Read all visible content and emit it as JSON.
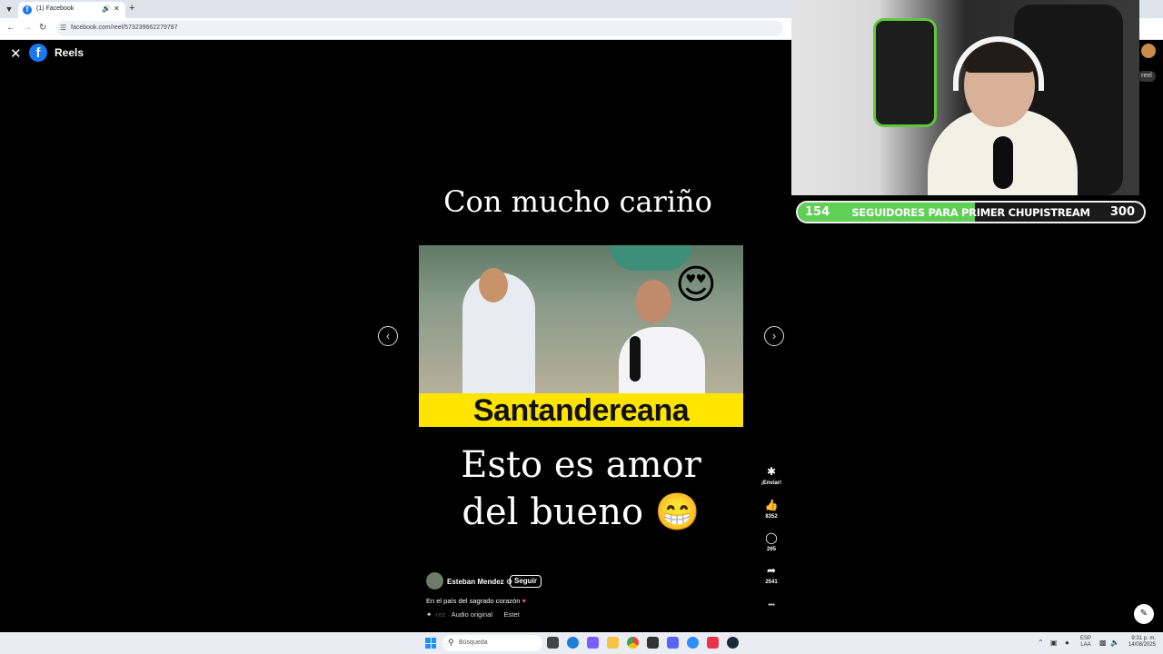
{
  "browser": {
    "tab_title": "(1) Facebook",
    "url": "facebook.com/reel/573239662279787",
    "icons": {
      "back": "arrow-left-icon",
      "forward": "arrow-right-icon",
      "reload": "reload-icon",
      "new_tab": "plus-icon"
    }
  },
  "header": {
    "title": "Reels",
    "close": "✕",
    "logo": "f"
  },
  "reel": {
    "caption_top": "Con mucho cariño",
    "video_banner": "Santandereana",
    "caption_bottom_line1": "Esto es amor",
    "caption_bottom_line2": "del bueno 😁",
    "author": "Esteban Mendez",
    "follow_label": "Seguir",
    "description": "En el país del sagrado corazón",
    "audio_prefix": "·rez ·",
    "audio_label": "Audio original",
    "audio_next": "Estet"
  },
  "actions": [
    {
      "name": "send",
      "icon": "✱",
      "label": "¡Enviar!"
    },
    {
      "name": "like",
      "icon": "👍",
      "label": "8352"
    },
    {
      "name": "comment",
      "icon": "◯",
      "label": "265"
    },
    {
      "name": "share",
      "icon": "➦",
      "label": "2541"
    },
    {
      "name": "more",
      "icon": "•••",
      "label": ""
    }
  ],
  "stream": {
    "followers_current": "154",
    "followers_goal": "300",
    "goal_text": "SEGUIDORES PARA PRIMER CHUPISTREAM",
    "progress_fraction": 0.513,
    "accent": "#5fcf55"
  },
  "sidebar_partial": {
    "reel_label": "reel"
  },
  "taskbar": {
    "search_placeholder": "Búsqueda",
    "lang_line1": "ESP",
    "lang_line2": "LAA",
    "time": "9:31 p. m.",
    "date": "14/08/2025"
  }
}
